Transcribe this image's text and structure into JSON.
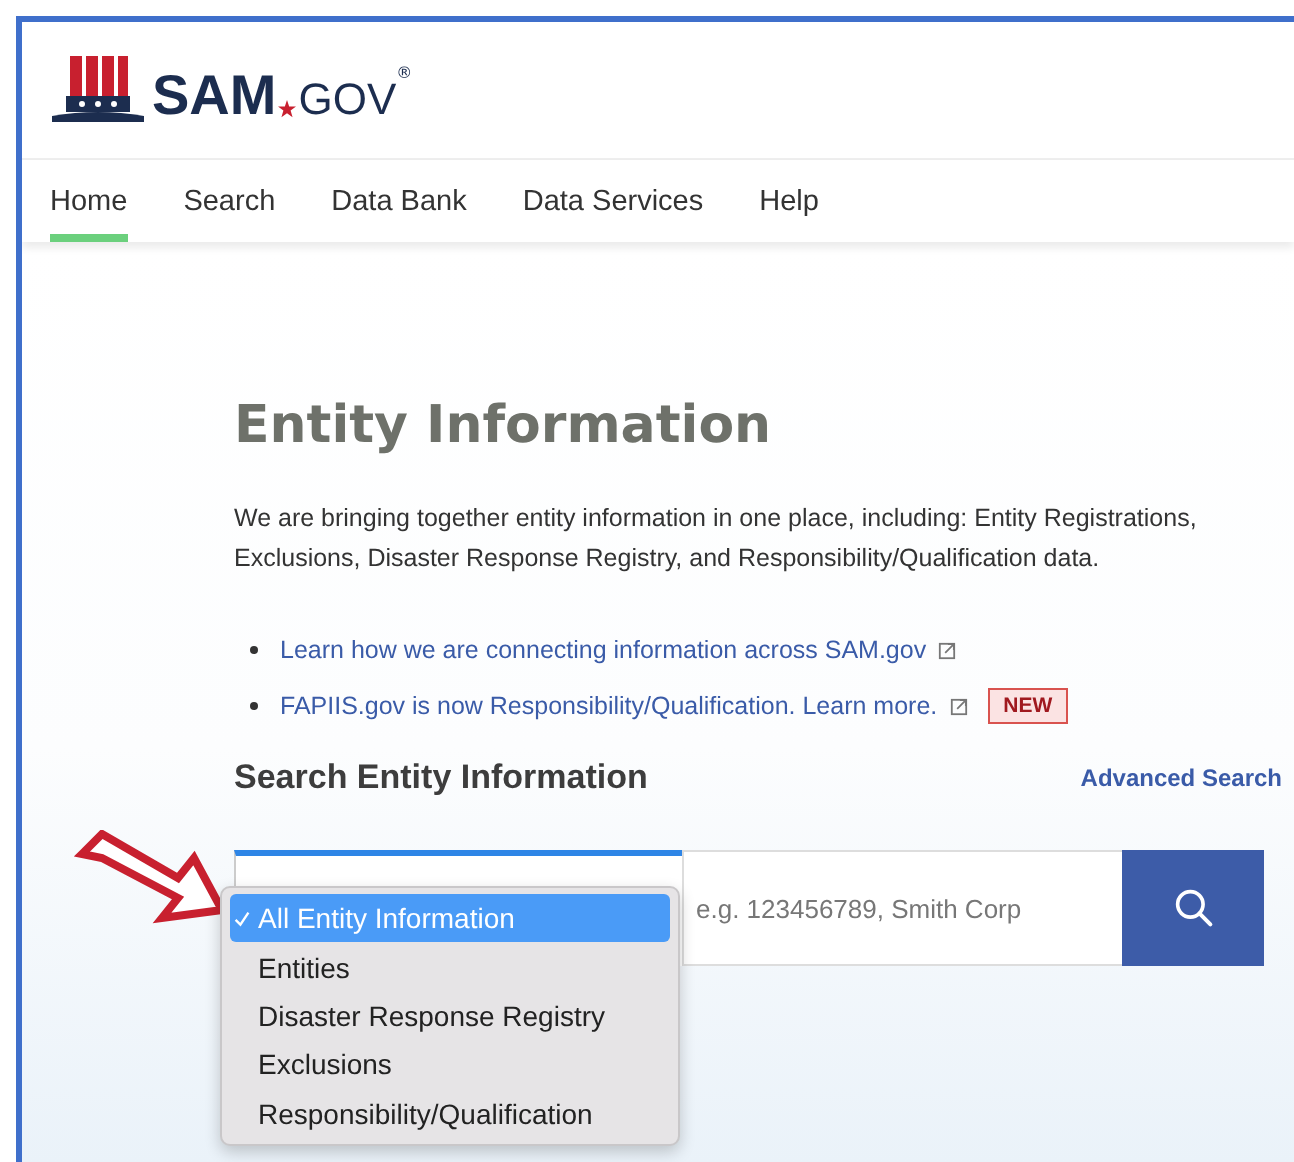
{
  "logo": {
    "name": "SAM",
    "suffix": "GOV",
    "mark": "®"
  },
  "nav": [
    {
      "label": "Home",
      "selected": true
    },
    {
      "label": "Search",
      "selected": false
    },
    {
      "label": "Data Bank",
      "selected": false
    },
    {
      "label": "Data Services",
      "selected": false
    },
    {
      "label": "Help",
      "selected": false
    }
  ],
  "title": "Entity Information",
  "intro": "We are bringing together entity information in one place, including: Entity Registrations, Exclusions, Disaster Response Registry, and Responsibility/Qualification data.",
  "links": [
    {
      "label": "Learn how we are connecting information across SAM.gov"
    },
    {
      "label": "FAPIIS.gov is now Responsibility/Qualification. Learn more.",
      "badge": "NEW"
    }
  ],
  "search": {
    "heading": "Search Entity Information",
    "advanced": "Advanced Search",
    "placeholder": "e.g. 123456789, Smith Corp",
    "options": [
      {
        "label": "All Entity Information",
        "selected": true
      },
      {
        "label": "Entities",
        "selected": false
      },
      {
        "label": "Disaster Response Registry",
        "selected": false
      },
      {
        "label": "Exclusions",
        "selected": false
      },
      {
        "label": "Responsibility/Qualification",
        "selected": false
      }
    ]
  }
}
